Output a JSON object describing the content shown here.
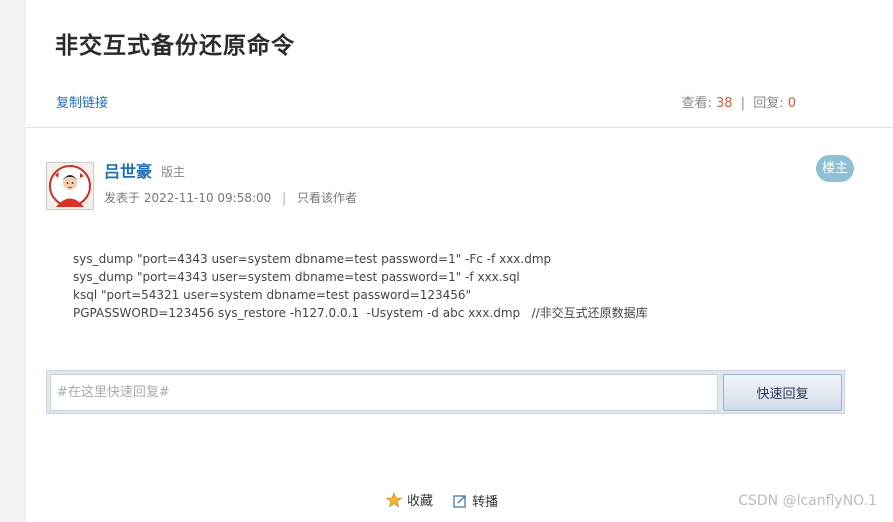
{
  "thread": {
    "title": "非交互式备份还原命令",
    "copy_link_label": "复制链接",
    "views_label": "查看:",
    "views": "38",
    "separator": "|",
    "replies_label": "回复:",
    "replies": "0"
  },
  "post": {
    "username": "吕世豪",
    "role": "版主",
    "posted_prefix": "发表于",
    "posted_time": "2022-11-10 09:58:00",
    "meta_separator": "|",
    "only_author_label": "只看该作者",
    "floor_badge": "楼主",
    "content_lines": [
      "sys_dump \"port=4343 user=system dbname=test password=1\" -Fc -f xxx.dmp",
      "sys_dump \"port=4343 user=system dbname=test password=1\" -f xxx.sql",
      "ksql \"port=54321 user=system dbname=test password=123456\"",
      "PGPASSWORD=123456 sys_restore -h127.0.0.1  -Usystem -d abc xxx.dmp   //非交互式还原数据库"
    ]
  },
  "reply": {
    "placeholder": "#在这里快速回复#",
    "button_label": "快速回复"
  },
  "actions": {
    "favorite_label": "收藏",
    "share_label": "转播"
  },
  "watermark": "CSDN @lcanflyNO.1",
  "icons": {
    "favorite": "star-icon",
    "share": "share-icon",
    "avatar": "avatar-portrait"
  },
  "colors": {
    "link": "#1f6fb3",
    "count": "#e05a3a",
    "badge": "#8fbfd4"
  }
}
